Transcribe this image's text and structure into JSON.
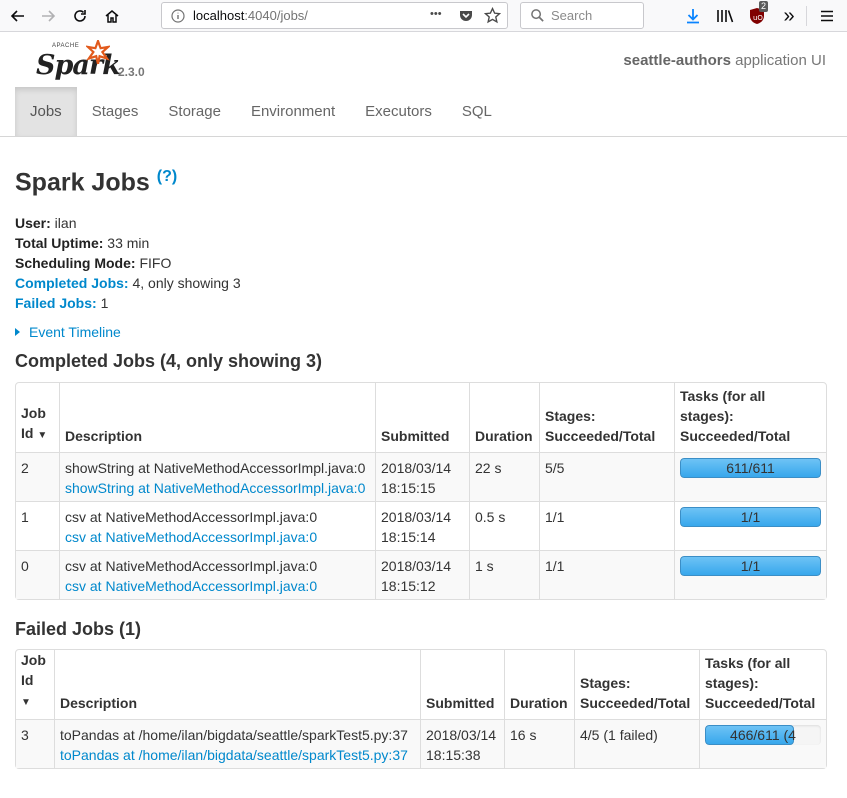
{
  "browser": {
    "url_host": "localhost",
    "url_rest": ":4040/jobs/",
    "search_placeholder": "Search",
    "menu_dots": "•••",
    "notification_badge": "2",
    "overflow_label": "»"
  },
  "header": {
    "logo_small_text": "APACHE",
    "logo_text": "Spark",
    "version": "2.3.0",
    "app_name": "seattle-authors",
    "app_suffix": " application UI",
    "tabs": [
      {
        "label": "Jobs"
      },
      {
        "label": "Stages"
      },
      {
        "label": "Storage"
      },
      {
        "label": "Environment"
      },
      {
        "label": "Executors"
      },
      {
        "label": "SQL"
      }
    ]
  },
  "page": {
    "title": "Spark Jobs",
    "help": "(?)",
    "summary": {
      "user_label": "User:",
      "user": " ilan",
      "uptime_label": "Total Uptime:",
      "uptime": " 33 min",
      "mode_label": "Scheduling Mode:",
      "mode": " FIFO",
      "completed_label": "Completed Jobs:",
      "completed": " 4, only showing 3",
      "failed_label": "Failed Jobs:",
      "failed": " 1"
    },
    "event_timeline": "Event Timeline"
  },
  "completed": {
    "title": "Completed Jobs (4, only showing 3)",
    "headers": {
      "job_id_1": "Job",
      "job_id_2": "Id",
      "sort": "▼",
      "description": "Description",
      "submitted": "Submitted",
      "duration": "Duration",
      "stages_1": "Stages:",
      "stages_2": "Succeeded/Total",
      "tasks_1": "Tasks (for all",
      "tasks_2": "stages):",
      "tasks_3": "Succeeded/Total"
    },
    "rows": [
      {
        "id": "2",
        "desc": "showString at NativeMethodAccessorImpl.java:0",
        "desc_link": "showString at NativeMethodAccessorImpl.java:0",
        "submitted_date": "2018/03/14",
        "submitted_time": "18:15:15",
        "duration": "22 s",
        "stages": "5/5",
        "tasks": "611/611",
        "tasks_fraction": 1.0
      },
      {
        "id": "1",
        "desc": "csv at NativeMethodAccessorImpl.java:0",
        "desc_link": "csv at NativeMethodAccessorImpl.java:0",
        "submitted_date": "2018/03/14",
        "submitted_time": "18:15:14",
        "duration": "0.5 s",
        "stages": "1/1",
        "tasks": "1/1",
        "tasks_fraction": 1.0
      },
      {
        "id": "0",
        "desc": "csv at NativeMethodAccessorImpl.java:0",
        "desc_link": "csv at NativeMethodAccessorImpl.java:0",
        "submitted_date": "2018/03/14",
        "submitted_time": "18:15:12",
        "duration": "1 s",
        "stages": "1/1",
        "tasks": "1/1",
        "tasks_fraction": 1.0
      }
    ]
  },
  "failed": {
    "title": "Failed Jobs (1)",
    "headers": {
      "job_id_1": "Job",
      "job_id_2": "Id",
      "sort": "▼",
      "description": "Description",
      "submitted": "Submitted",
      "duration": "Duration",
      "stages_1": "Stages:",
      "stages_2": "Succeeded/Total",
      "tasks_1": "Tasks (for all",
      "tasks_2": "stages):",
      "tasks_3": "Succeeded/Total"
    },
    "rows": [
      {
        "id": "3",
        "desc": "toPandas at /home/ilan/bigdata/seattle/sparkTest5.py:37",
        "desc_link": "toPandas at /home/ilan/bigdata/seattle/sparkTest5.py:37",
        "submitted_date": "2018/03/14",
        "submitted_time": "18:15:38",
        "duration": "16 s",
        "stages": "4/5 (1 failed)",
        "tasks": "466/611 (4",
        "tasks_fraction": 0.763
      }
    ]
  },
  "colors": {
    "link": "#0088cc",
    "progress": "#37a7ec",
    "logo_accent": "#e25a1c"
  }
}
